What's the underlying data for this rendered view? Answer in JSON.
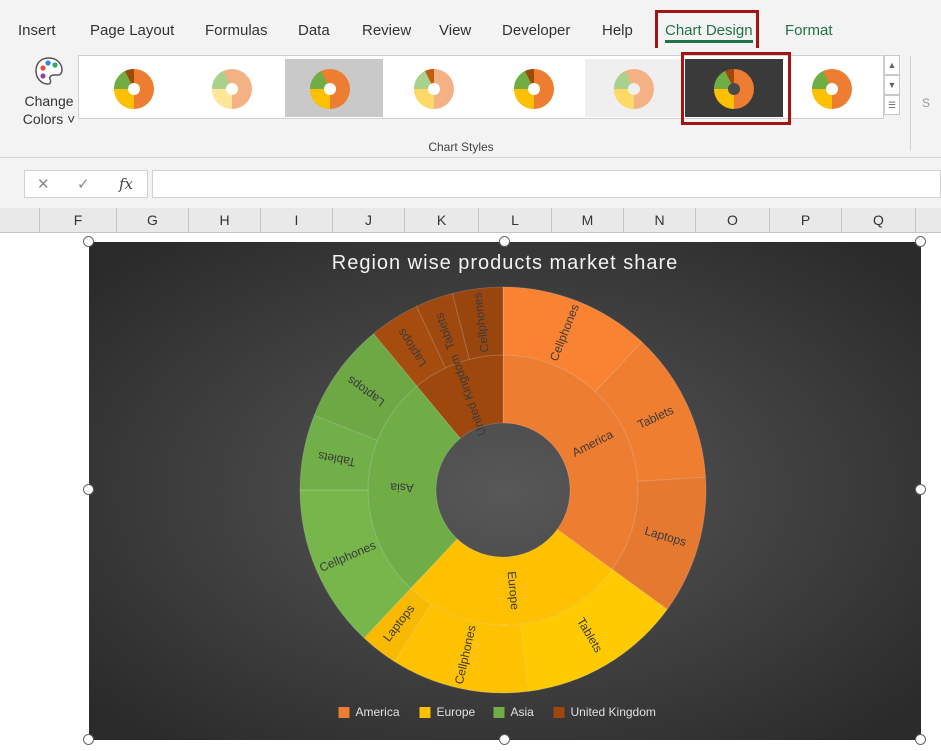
{
  "ribbon": {
    "tabs": [
      "Insert",
      "Page Layout",
      "Formulas",
      "Data",
      "Review",
      "View",
      "Developer",
      "Help",
      "Chart Design",
      "Format"
    ],
    "active_tab": "Chart Design",
    "change_colors_label_1": "Change",
    "change_colors_label_2": "Colors ˅",
    "group_label": "Chart Styles",
    "selected_style_index": 7,
    "clipped_label": "S"
  },
  "formula_bar": {
    "cancel_icon": "✕",
    "enter_icon": "✓",
    "fx_label": "fx",
    "value": ""
  },
  "columns": [
    "F",
    "G",
    "H",
    "I",
    "J",
    "K",
    "L",
    "M",
    "N",
    "O",
    "P",
    "Q"
  ],
  "colors": {
    "accent": "#217346",
    "highlight_border": "#a31515",
    "america": "#ed7d31",
    "europe": "#ffc000",
    "asia": "#70ad47",
    "united_kingdom": "#9e480e",
    "chart_bg": "#3a3a3a"
  },
  "chart_data": {
    "type": "sunburst",
    "title": "Region wise products market share",
    "legend_position": "bottom",
    "series": [
      {
        "name": "America",
        "value": 35,
        "children": [
          {
            "name": "Cellphones",
            "value": 12
          },
          {
            "name": "Tablets",
            "value": 12
          },
          {
            "name": "Laptops",
            "value": 11
          }
        ]
      },
      {
        "name": "Europe",
        "value": 27,
        "children": [
          {
            "name": "Tablets",
            "value": 13
          },
          {
            "name": "Cellphones",
            "value": 11
          },
          {
            "name": "Laptops",
            "value": 3
          }
        ]
      },
      {
        "name": "Asia",
        "value": 27,
        "children": [
          {
            "name": "Cellphones",
            "value": 13
          },
          {
            "name": "Tablets",
            "value": 6
          },
          {
            "name": "Laptops",
            "value": 8
          }
        ]
      },
      {
        "name": "United Kingdom",
        "value": 11,
        "children": [
          {
            "name": "Laptops",
            "value": 4
          },
          {
            "name": "Tablets",
            "value": 3
          },
          {
            "name": "Cellphones",
            "value": 4
          }
        ]
      }
    ]
  }
}
